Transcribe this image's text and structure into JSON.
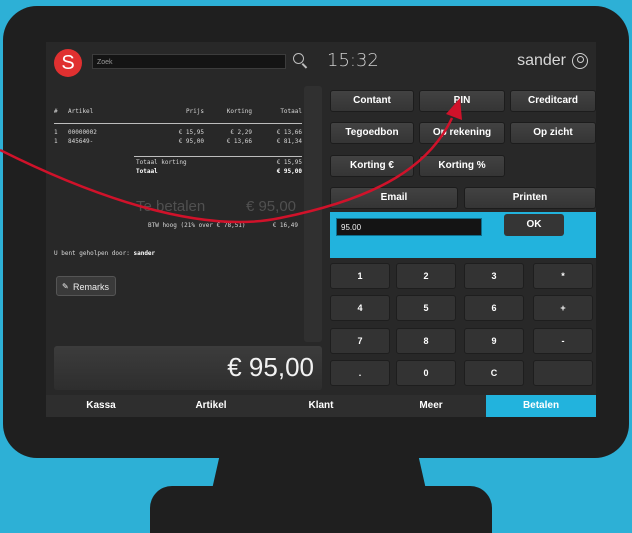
{
  "header": {
    "logo_letter": "S",
    "search_placeholder": "Zoek",
    "clock": "15:32",
    "user": "sander"
  },
  "receipt": {
    "headers": {
      "num": "#",
      "article": "Artikel",
      "price": "Prijs",
      "discount": "Korting",
      "total": "Totaal"
    },
    "rows": [
      {
        "num": "1",
        "article": "00000002",
        "price": "€ 15,95",
        "discount": "€ 2,29",
        "total": "€ 13,66"
      },
      {
        "num": "1",
        "article": "845649-",
        "price": "€ 95,00",
        "discount": "€ 13,66",
        "total": "€ 81,34"
      }
    ],
    "total_discount_label": "Totaal korting",
    "total_discount_value": "€ 15,95",
    "total_label": "Totaal",
    "total_value": "€ 95,00",
    "to_pay_label": "Te betalen",
    "to_pay_value": "€ 95,00",
    "vat_label": "BTW hoog (21% over € 78,51)",
    "vat_value": "€ 16,49",
    "helped_by_label": "U bent geholpen door:",
    "helped_by_name": "sander",
    "remarks_label": "Remarks"
  },
  "grand_total": "€ 95,00",
  "payment_buttons": [
    "Contant",
    "PIN",
    "Creditcard",
    "Tegoedbon",
    "Op rekening",
    "Op zicht",
    "Korting €",
    "Korting %",
    "Email",
    "Printen"
  ],
  "amount": {
    "value": "95.00",
    "ok_label": "OK"
  },
  "keypad": [
    "1",
    "2",
    "3",
    "*",
    "4",
    "5",
    "6",
    "+",
    "7",
    "8",
    "9",
    "-",
    ".",
    "0",
    "C",
    ""
  ],
  "nav": [
    {
      "label": "Kassa"
    },
    {
      "label": "Artikel"
    },
    {
      "label": "Klant"
    },
    {
      "label": "Meer"
    },
    {
      "label": "Betalen",
      "active": true
    }
  ],
  "colors": {
    "accent": "#22b3dd",
    "logo": "#e03030",
    "arrow": "#d0122a",
    "background": "#2db0d6"
  }
}
